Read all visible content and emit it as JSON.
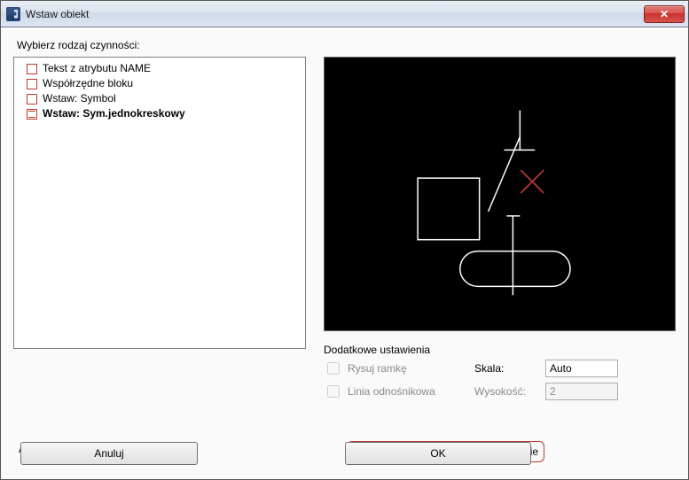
{
  "window": {
    "title": "Wstaw obiekt"
  },
  "prompt": "Wybierz rodzaj czynności:",
  "tree": {
    "items": [
      {
        "label": "Tekst z atrybutu NAME",
        "selected": false
      },
      {
        "label": "Współrzędne bloku",
        "selected": false
      },
      {
        "label": "Wstaw: Symbol",
        "selected": false
      },
      {
        "label": "Wstaw: Sym.jednokreskowy",
        "selected": true
      }
    ]
  },
  "settings": {
    "group_title": "Dodatkowe ustawienia",
    "draw_frame_label": "Rysuj ramkę",
    "draw_frame_checked": false,
    "leader_line_label": "Linia odnośnikowa",
    "leader_line_checked": false,
    "scale_label": "Skala:",
    "scale_value": "Auto",
    "height_label": "Wysokość:",
    "height_value": "2"
  },
  "repeat": {
    "label": "Powtarzaj polecenie automatycznie",
    "checked": true
  },
  "unit": {
    "label": "Aktualna jednostka: milimetry"
  },
  "buttons": {
    "cancel": "Anuluj",
    "ok": "OK"
  }
}
